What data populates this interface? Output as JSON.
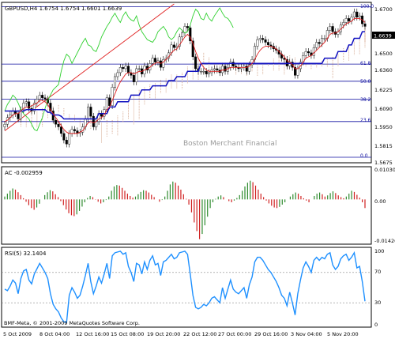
{
  "chart_data": [
    {
      "type": "line",
      "title": "GBPUSD,H4  1.6754 1.6754 1.6601 1.6639",
      "watermark": "Boston Merchant Financial",
      "ylim": [
        1.562,
        1.681
      ],
      "y_ticks": [
        "1.6700",
        "1.6500",
        "1.6360",
        "1.6225",
        "1.6090",
        "1.5950",
        "1.5815",
        "1.5675"
      ],
      "current_price_label": "1.6639",
      "fib_levels": [
        {
          "label": "100.0",
          "price": 1.679
        },
        {
          "label": "61.8",
          "price": 1.6355
        },
        {
          "label": "50.0",
          "price": 1.6225
        },
        {
          "label": "38.2",
          "price": 1.609
        },
        {
          "label": "23.6",
          "price": 1.592
        },
        {
          "label": "0.0",
          "price": 1.565
        }
      ],
      "series": [
        {
          "name": "close",
          "values": [
            1.59,
            1.595,
            1.597,
            1.6,
            1.598,
            1.594,
            1.601,
            1.606,
            1.607,
            1.602,
            1.6,
            1.606,
            1.609,
            1.612,
            1.61,
            1.609,
            1.606,
            1.6,
            1.593,
            1.59,
            1.588,
            1.583,
            1.578,
            1.575,
            1.583,
            1.586,
            1.585,
            1.583,
            1.584,
            1.588,
            1.594,
            1.603,
            1.596,
            1.588,
            1.592,
            1.598,
            1.596,
            1.601,
            1.61,
            1.604,
            1.618,
            1.626,
            1.629,
            1.633,
            1.632,
            1.634,
            1.629,
            1.627,
            1.622,
            1.632,
            1.632,
            1.628,
            1.634,
            1.631,
            1.636,
            1.64,
            1.637,
            1.638,
            1.633,
            1.639,
            1.64,
            1.644,
            1.65,
            1.648,
            1.649,
            1.656,
            1.659,
            1.664,
            1.663,
            1.653,
            1.641,
            1.632,
            1.63,
            1.63,
            1.63,
            1.628,
            1.629,
            1.631,
            1.632,
            1.631,
            1.629,
            1.634,
            1.63,
            1.633,
            1.637,
            1.634,
            1.633,
            1.632,
            1.633,
            1.634,
            1.63,
            1.635,
            1.639,
            1.649,
            1.654,
            1.655,
            1.654,
            1.652,
            1.65,
            1.649,
            1.647,
            1.646,
            1.643,
            1.64,
            1.639,
            1.634,
            1.637,
            1.633,
            1.627,
            1.632,
            1.637,
            1.642,
            1.645,
            1.644,
            1.642,
            1.648,
            1.652,
            1.651,
            1.655,
            1.655,
            1.661,
            1.664,
            1.66,
            1.658,
            1.66,
            1.665,
            1.667,
            1.67,
            1.668,
            1.671,
            1.675,
            1.671,
            1.672,
            1.666,
            1.664
          ]
        },
        {
          "name": "tenkan",
          "values": [
            1.592,
            1.593,
            1.595,
            1.597,
            1.598,
            1.598,
            1.6,
            1.602,
            1.603,
            1.603,
            1.604,
            1.605,
            1.606,
            1.608,
            1.608,
            1.607,
            1.605,
            1.601,
            1.598,
            1.595,
            1.592,
            1.589,
            1.586,
            1.584,
            1.583,
            1.583,
            1.583,
            1.583,
            1.584,
            1.585,
            1.588,
            1.591,
            1.592,
            1.591,
            1.592,
            1.594,
            1.595,
            1.597,
            1.601,
            1.603,
            1.608,
            1.613,
            1.618,
            1.622,
            1.625,
            1.628,
            1.629,
            1.629,
            1.628,
            1.629,
            1.63,
            1.63,
            1.631,
            1.632,
            1.633,
            1.635,
            1.636,
            1.637,
            1.636,
            1.637,
            1.639,
            1.641,
            1.644,
            1.646,
            1.647,
            1.65,
            1.653,
            1.656,
            1.658,
            1.656,
            1.651,
            1.645,
            1.64,
            1.636,
            1.633,
            1.631,
            1.63,
            1.63,
            1.63,
            1.63,
            1.63,
            1.631,
            1.631,
            1.632,
            1.633,
            1.633,
            1.633,
            1.633,
            1.633,
            1.633,
            1.633,
            1.634,
            1.636,
            1.639,
            1.643,
            1.646,
            1.648,
            1.649,
            1.649,
            1.649,
            1.648,
            1.647,
            1.645,
            1.643,
            1.641,
            1.638,
            1.637,
            1.635,
            1.632,
            1.632,
            1.634,
            1.637,
            1.64,
            1.641,
            1.642,
            1.644,
            1.646,
            1.648,
            1.65,
            1.652,
            1.655,
            1.658,
            1.659,
            1.659,
            1.66,
            1.662,
            1.664,
            1.666,
            1.667,
            1.668,
            1.67,
            1.67,
            1.67,
            1.669,
            1.667
          ]
        },
        {
          "name": "kijun",
          "values": [
            1.6,
            1.6,
            1.6,
            1.6,
            1.6,
            1.6,
            1.6,
            1.6,
            1.601,
            1.601,
            1.601,
            1.601,
            1.601,
            1.601,
            1.601,
            1.601,
            1.599,
            1.599,
            1.597,
            1.597,
            1.597,
            1.596,
            1.594,
            1.594,
            1.594,
            1.594,
            1.594,
            1.594,
            1.594,
            1.594,
            1.594,
            1.594,
            1.594,
            1.594,
            1.594,
            1.598,
            1.598,
            1.598,
            1.598,
            1.603,
            1.603,
            1.603,
            1.607,
            1.607,
            1.607,
            1.607,
            1.607,
            1.612,
            1.612,
            1.612,
            1.612,
            1.616,
            1.616,
            1.616,
            1.616,
            1.619,
            1.619,
            1.619,
            1.619,
            1.619,
            1.619,
            1.623,
            1.623,
            1.623,
            1.626,
            1.626,
            1.626,
            1.626,
            1.63,
            1.63,
            1.63,
            1.63,
            1.63,
            1.636,
            1.636,
            1.636,
            1.636,
            1.636,
            1.636,
            1.636,
            1.636,
            1.636,
            1.636,
            1.636,
            1.636,
            1.636,
            1.636,
            1.636,
            1.636,
            1.636,
            1.636,
            1.636,
            1.636,
            1.636,
            1.636,
            1.636,
            1.636,
            1.636,
            1.636,
            1.636,
            1.636,
            1.636,
            1.636,
            1.636,
            1.636,
            1.636,
            1.636,
            1.636,
            1.636,
            1.636,
            1.636,
            1.636,
            1.636,
            1.636,
            1.636,
            1.636,
            1.636,
            1.636,
            1.636,
            1.64,
            1.64,
            1.64,
            1.64,
            1.64,
            1.645,
            1.645,
            1.645,
            1.645,
            1.65,
            1.65,
            1.655,
            1.655,
            1.655,
            1.66,
            1.66
          ]
        },
        {
          "name": "chikou",
          "values": [
            1.6,
            1.605,
            1.608,
            1.612,
            1.61,
            1.606,
            1.601,
            1.598,
            1.596,
            1.594,
            1.59,
            1.586,
            1.585,
            1.59,
            1.595,
            1.602,
            1.608,
            1.612,
            1.616,
            1.618,
            1.62,
            1.63,
            1.638,
            1.643,
            1.641,
            1.636,
            1.64,
            1.644,
            1.648,
            1.652,
            1.655,
            1.65,
            1.649,
            1.646,
            1.645,
            1.65,
            1.656,
            1.66,
            1.664,
            1.667,
            1.671,
            1.674,
            1.67,
            1.667,
            1.672,
            1.675,
            1.671,
            1.669,
            1.668,
            1.672,
            1.665,
            1.66,
            1.657,
            1.654,
            1.653,
            1.652,
            1.655,
            1.66,
            1.662,
            1.664,
            1.661,
            1.656,
            1.654,
            1.656,
            1.66,
            1.663,
            1.661,
            1.659,
            1.66,
            1.665,
            1.672,
            1.677,
            1.675,
            1.67,
            1.669,
            1.674,
            1.67,
            1.668,
            1.672,
            1.675,
            1.678,
            1.674,
            1.671,
            1.67,
            1.667,
            1.663
          ]
        }
      ]
    },
    {
      "type": "bar",
      "title": "AC -0.002959",
      "y_ticks": [
        "0.010305",
        "0.00",
        "-0.014263"
      ],
      "ylim": [
        -0.015,
        0.0108
      ],
      "positive_color": "#2e8b2e",
      "negative_color": "#d02020",
      "values": [
        0.001,
        0.002,
        0.003,
        0.0038,
        0.0034,
        0.0025,
        0.0015,
        0.0004,
        -0.0008,
        -0.002,
        -0.003,
        -0.0036,
        -0.0028,
        -0.0015,
        0.0,
        0.0015,
        0.0025,
        0.0032,
        0.0028,
        0.0018,
        0.0008,
        -0.0006,
        -0.002,
        -0.0035,
        -0.0048,
        -0.0055,
        -0.0058,
        -0.0052,
        -0.004,
        -0.0025,
        -0.001,
        0.0005,
        0.0012,
        0.0008,
        0.0001,
        -0.0008,
        -0.0014,
        -0.001,
        -0.0002,
        0.001,
        0.003,
        0.0045,
        0.005,
        0.0048,
        0.004,
        0.003,
        0.002,
        0.0012,
        0.0006,
        0.001,
        0.0018,
        0.0026,
        0.0032,
        0.003,
        0.0024,
        0.0016,
        0.0008,
        0.0,
        -0.0008,
        -0.0002,
        0.001,
        0.003,
        0.0052,
        0.0062,
        0.0058,
        0.0048,
        0.0034,
        0.0018,
        0.0002,
        -0.0018,
        -0.0045,
        -0.008,
        -0.011,
        -0.0138,
        -0.012,
        -0.009,
        -0.006,
        -0.003,
        -0.001,
        0.0002,
        0.001,
        0.0014,
        0.0008,
        0.0,
        -0.0006,
        -0.001,
        -0.0004,
        0.0005,
        0.0015,
        0.003,
        0.0045,
        0.0058,
        0.0065,
        0.006,
        0.0048,
        0.0034,
        0.002,
        0.0008,
        -0.0004,
        -0.0014,
        -0.0022,
        -0.0028,
        -0.003,
        -0.0026,
        -0.0018,
        -0.001,
        0.0,
        0.001,
        0.0018,
        0.0024,
        0.002,
        0.0012,
        0.0004,
        -0.0004,
        -0.001,
        0.0,
        0.0012,
        0.002,
        0.0024,
        0.0018,
        0.001,
        0.0014,
        0.0022,
        0.0028,
        0.0022,
        0.0014,
        0.0008,
        0.0004,
        0.001,
        0.002,
        0.003,
        0.0026,
        0.0016,
        0.0006,
        -0.001,
        -0.003
      ]
    },
    {
      "type": "line",
      "title": "RSI(5) 32.1404",
      "y_ticks": [
        "100",
        "70",
        "30",
        "0"
      ],
      "ylim": [
        0,
        100
      ],
      "values": [
        48,
        46,
        52,
        60,
        56,
        42,
        62,
        72,
        74,
        60,
        55,
        68,
        75,
        82,
        76,
        70,
        62,
        42,
        28,
        22,
        18,
        10,
        5,
        4,
        40,
        50,
        44,
        36,
        40,
        52,
        66,
        82,
        58,
        42,
        52,
        64,
        56,
        68,
        82,
        62,
        92,
        96,
        97,
        98,
        94,
        96,
        78,
        70,
        58,
        82,
        80,
        68,
        84,
        74,
        86,
        92,
        80,
        82,
        66,
        84,
        86,
        90,
        94,
        88,
        90,
        96,
        97,
        98,
        94,
        68,
        40,
        24,
        22,
        24,
        28,
        26,
        30,
        36,
        38,
        34,
        30,
        50,
        36,
        48,
        60,
        48,
        44,
        42,
        46,
        50,
        36,
        54,
        64,
        84,
        90,
        90,
        86,
        80,
        74,
        70,
        64,
        58,
        50,
        40,
        36,
        26,
        44,
        30,
        14,
        42,
        60,
        76,
        84,
        78,
        70,
        86,
        90,
        86,
        90,
        88,
        94,
        96,
        80,
        74,
        78,
        88,
        92,
        94,
        86,
        90,
        96,
        76,
        78,
        58,
        32
      ]
    }
  ],
  "x_axis": {
    "labels": [
      "5 Oct 2009",
      "8 Oct 04:00",
      "12 Oct 16:00",
      "15 Oct 08:00",
      "19 Oct 20:00",
      "22 Oct 12:00",
      "27 Oct 00:00",
      "29 Oct 16:00",
      "3 Nov 04:00",
      "5 Nov 20:00"
    ]
  },
  "footer": "BMF-Meta, © 2001-2009 MetaQuotes Software Corp.",
  "colors": {
    "close": "#000000",
    "tenkan": "#e02020",
    "kijun": "#1010c0",
    "chikou": "#30d030",
    "trendline": "#e02020",
    "fib": "#1010a0",
    "cloud": "#d4a48a",
    "rsi": "#1e90ff"
  }
}
